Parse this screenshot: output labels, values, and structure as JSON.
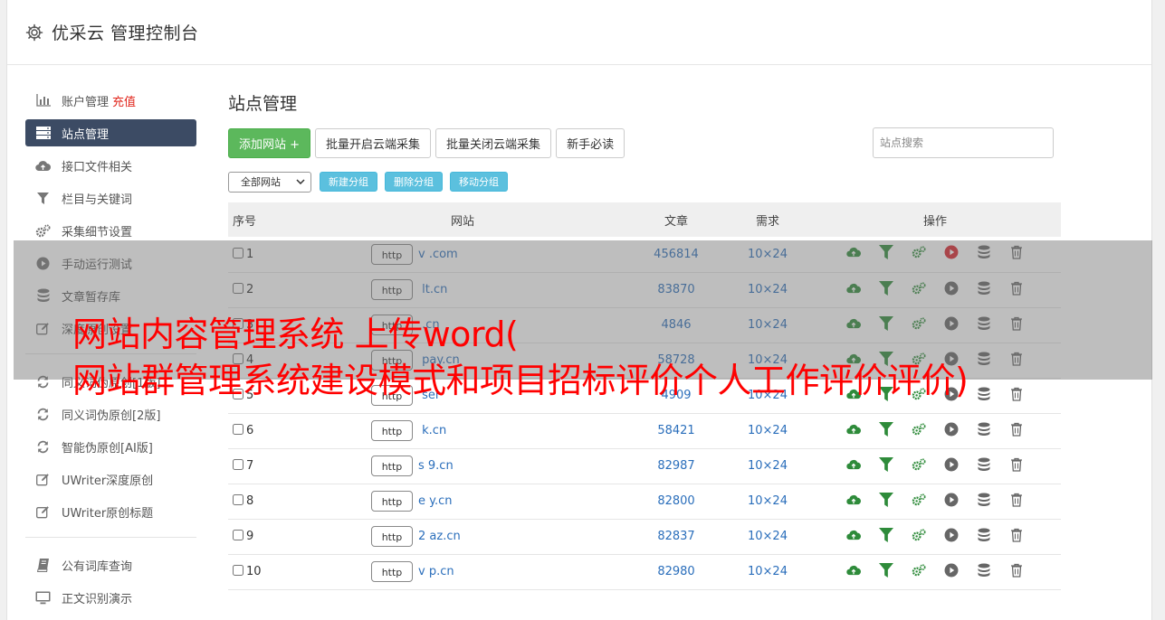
{
  "header": {
    "title": "优采云 管理控制台"
  },
  "sidebar": {
    "items": [
      {
        "label": "账户管理",
        "extra": "充值"
      },
      {
        "label": "站点管理"
      },
      {
        "label": "接口文件相关"
      },
      {
        "label": "栏目与关键词"
      },
      {
        "label": "采集细节设置"
      },
      {
        "label": "手动运行测试"
      },
      {
        "label": "文章暂存库"
      },
      {
        "label": "深度原创设置"
      }
    ],
    "items2": [
      {
        "label": "同义词伪原创[1版]"
      },
      {
        "label": "同义词伪原创[2版]"
      },
      {
        "label": "智能伪原创[AI版]"
      },
      {
        "label": "UWriter深度原创"
      },
      {
        "label": "UWriter原创标题"
      }
    ],
    "items3": [
      {
        "label": "公有词库查询"
      },
      {
        "label": "正文识别演示"
      }
    ]
  },
  "main": {
    "title": "站点管理",
    "toolbar": {
      "add": "添加网站 +",
      "open_all": "批量开启云端采集",
      "close_all": "批量关闭云端采集",
      "guide": "新手必读",
      "search_placeholder": "站点搜索"
    },
    "toolbar2": {
      "select_value": "全部网站",
      "new_group": "新建分组",
      "delete_group": "删除分组",
      "move_group": "移动分组"
    },
    "table": {
      "headers": {
        "no": "序号",
        "site": "网站",
        "articles": "文章",
        "demand": "需求",
        "ops": "操作"
      },
      "http_label": "http",
      "rows": [
        {
          "no": "1",
          "site": "v         .com",
          "articles": "456814",
          "demand": "10×24"
        },
        {
          "no": "2",
          "site": "     lt.cn",
          "articles": "83870",
          "demand": "10×24"
        },
        {
          "no": "3",
          "site": "       .cn",
          "articles": "4846",
          "demand": "10×24"
        },
        {
          "no": "4",
          "site": "      pay.cn",
          "articles": "58728",
          "demand": "10×24"
        },
        {
          "no": "5",
          "site": "      ser",
          "articles": "4909",
          "demand": "10×24"
        },
        {
          "no": "6",
          "site": "     k.cn",
          "articles": "58421",
          "demand": "10×24"
        },
        {
          "no": "7",
          "site": "s   9.cn",
          "articles": "82987",
          "demand": "10×24"
        },
        {
          "no": "8",
          "site": "e     y.cn",
          "articles": "82800",
          "demand": "10×24"
        },
        {
          "no": "9",
          "site": "2    az.cn",
          "articles": "82837",
          "demand": "10×24"
        },
        {
          "no": "10",
          "site": "v    p.cn",
          "articles": "82980",
          "demand": "10×24"
        }
      ]
    }
  },
  "overlay": {
    "line1": "网站内容管理系统 上传word(",
    "line2": "网站群管理系统建设模式和项目招标评价个人工作评价评价)"
  },
  "colors": {
    "accent_green": "#5cb85c",
    "accent_blue": "#5bc0de",
    "nav_active": "#3c4b64",
    "link": "#2a6ebb",
    "headline": "#ff0000"
  },
  "icons": [
    "gear-icon",
    "chart-icon",
    "server-icon",
    "cloud-upload-icon",
    "filter-icon",
    "cogs-icon",
    "play-icon",
    "database-icon",
    "edit-icon",
    "refresh-icon",
    "book-icon",
    "monitor-icon",
    "trash-icon"
  ]
}
